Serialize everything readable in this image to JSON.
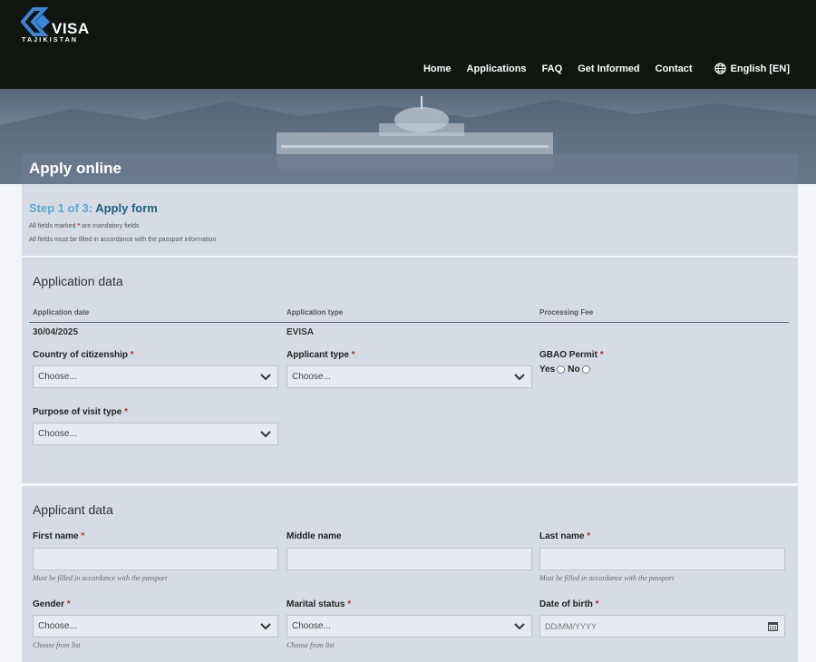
{
  "header": {
    "logo_text": "VISA",
    "logo_country": "TAJIKISTAN",
    "nav": [
      "Home",
      "Applications",
      "FAQ",
      "Get Informed",
      "Contact"
    ],
    "language": "English",
    "language_code": "[EN]"
  },
  "page": {
    "title": "Apply online",
    "step_number": "Step 1 of 3:",
    "step_name": "Apply form",
    "note_mandatory_prefix": "All fields marked",
    "note_mandatory_star": "*",
    "note_mandatory_suffix": "are mandatory fields",
    "note_passport": "All fields must be filled in accordance with the passport information"
  },
  "application_data": {
    "section_title": "Application data",
    "col_application_date": "Application date",
    "col_application_type": "Application type",
    "col_processing_fee": "Processing Fee",
    "application_date": "30/04/2025",
    "application_type": "EVISA",
    "processing_fee": "",
    "country_label": "Country of citizenship",
    "country_value": "Choose...",
    "applicant_type_label": "Applicant type",
    "applicant_type_value": "Choose...",
    "gbao_label": "GBAO Permit",
    "gbao_yes": "Yes",
    "gbao_no": "No",
    "purpose_label": "Purpose of visit type",
    "purpose_value": "Choose..."
  },
  "applicant_data": {
    "section_title": "Applicant data",
    "first_name_label": "First name",
    "middle_name_label": "Middle name",
    "last_name_label": "Last name",
    "first_name_hint": "Must be filled in accordance with the passport",
    "last_name_hint": "Must be filled in accordance with the passport",
    "gender_label": "Gender",
    "gender_value": "Choose...",
    "gender_hint": "Choose from list",
    "marital_label": "Marital status",
    "marital_value": "Choose...",
    "marital_hint": "Choose from list",
    "dob_label": "Date of birth",
    "dob_placeholder": "DD/MM/YYYY"
  },
  "required_mark": "*",
  "colors": {
    "header_bg": "#101510",
    "panel_bg": "#d6dce4",
    "accent_blue": "#1d5f86",
    "required_red": "#c0262d",
    "logo_blue": "#3b86d6"
  }
}
